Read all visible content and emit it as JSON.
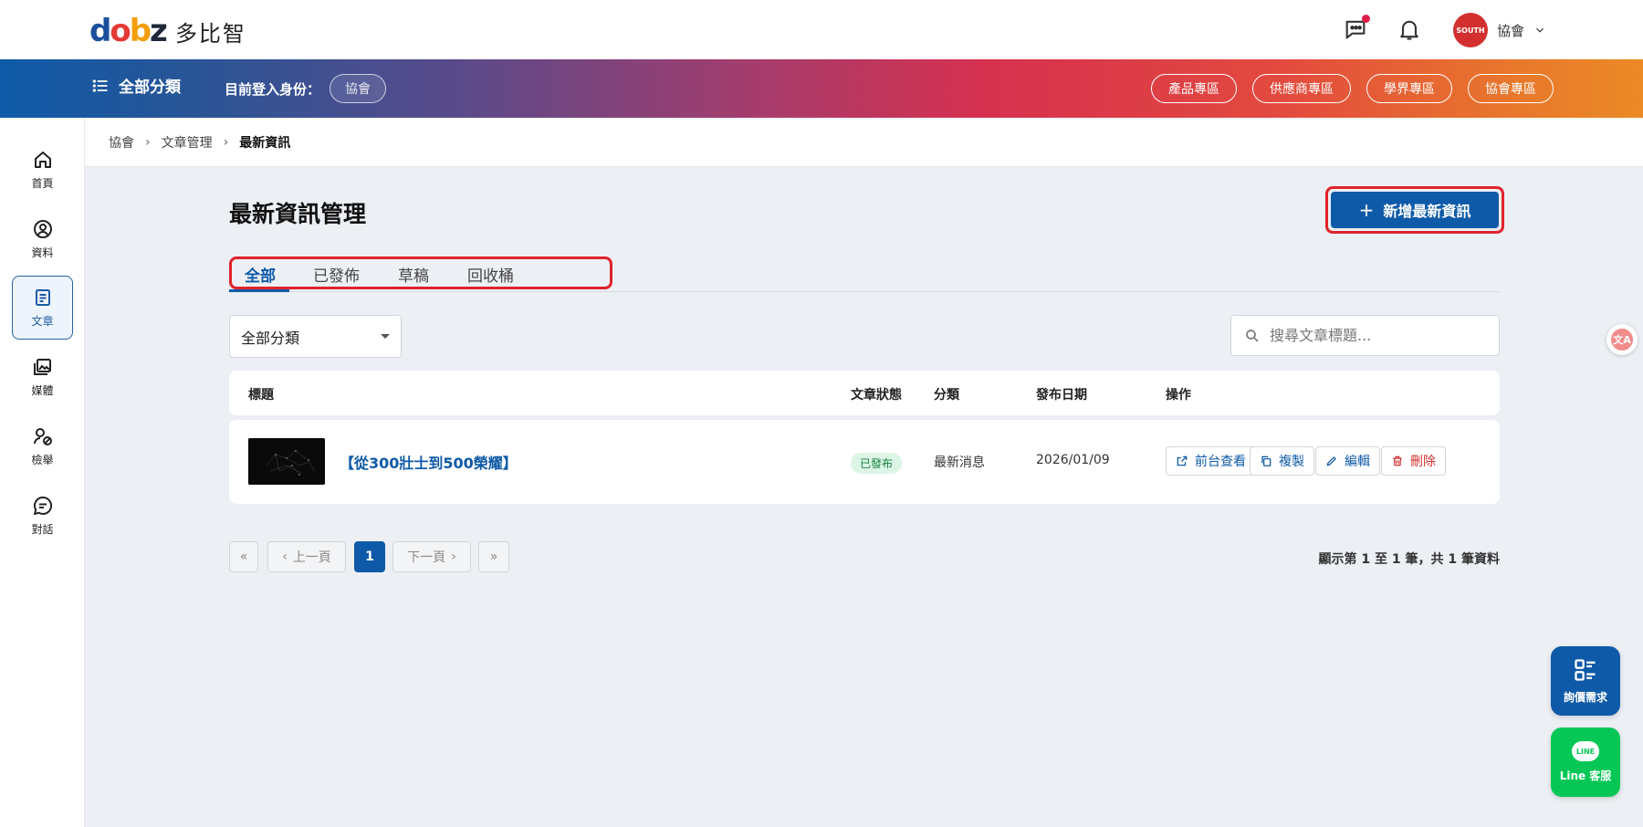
{
  "brand": {
    "logo_mark": [
      "d",
      "o",
      "b",
      "z"
    ],
    "logo_text": "多比智"
  },
  "header": {
    "user_name": "協會",
    "avatar_text": "SOUTH"
  },
  "nav": {
    "all_categories": "全部分類",
    "login_label": "目前登入身份：",
    "role": "協會",
    "zones": [
      "產品專區",
      "供應商專區",
      "學界專區",
      "協會專區"
    ]
  },
  "sidebar": {
    "items": [
      {
        "label": "首頁",
        "icon": "home-icon"
      },
      {
        "label": "資料",
        "icon": "user-circle-icon"
      },
      {
        "label": "文章",
        "icon": "document-icon",
        "active": true
      },
      {
        "label": "媒體",
        "icon": "media-icon"
      },
      {
        "label": "檢舉",
        "icon": "report-icon"
      },
      {
        "label": "對話",
        "icon": "chat-icon"
      }
    ]
  },
  "breadcrumb": [
    "協會",
    "文章管理",
    "最新資訊"
  ],
  "page": {
    "title": "最新資訊管理",
    "add_button": "新增最新資訊",
    "tabs": [
      "全部",
      "已發佈",
      "草稿",
      "回收桶"
    ],
    "category_filter": "全部分類",
    "search_placeholder": "搜尋文章標題..."
  },
  "table": {
    "columns": [
      "標題",
      "文章狀態",
      "分類",
      "發布日期",
      "操作"
    ],
    "rows": [
      {
        "title": "【從300壯士到500榮耀】",
        "status": "已發布",
        "category": "最新消息",
        "date": "2026/01/09",
        "actions": [
          "前台查看",
          "複製",
          "編輯",
          "刪除"
        ]
      }
    ]
  },
  "pagination": {
    "prev": "上一頁",
    "next": "下一頁",
    "current": "1",
    "summary": "顯示第 1 至 1 筆，共 1 筆資料"
  },
  "fabs": {
    "translate": "文A",
    "quote": "詢價需求",
    "line_icon": "LINE",
    "line": "Line 客服"
  },
  "colors": {
    "primary": "#0f5aa8",
    "highlight": "#e0232b",
    "success": "#15803d",
    "danger": "#d32f2f",
    "line_green": "#06c755"
  }
}
